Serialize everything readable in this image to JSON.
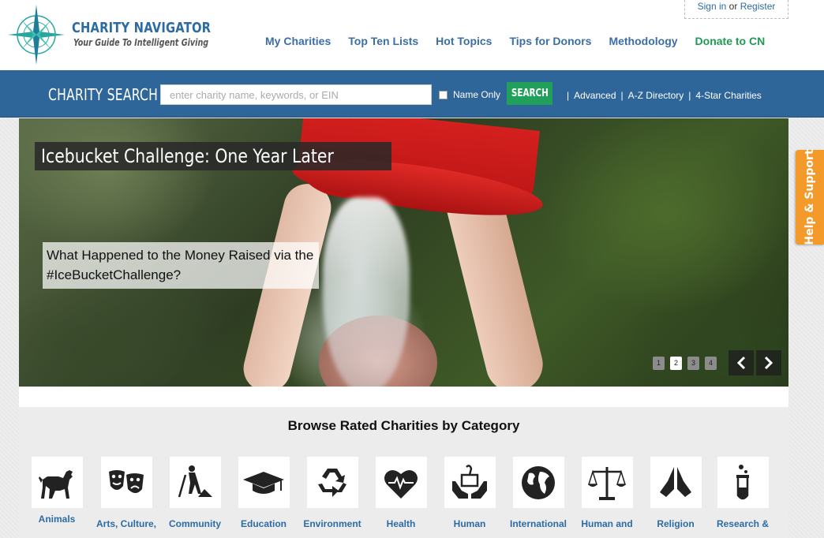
{
  "brand": {
    "title": "CHARITY NAVIGATOR",
    "tagline": "Your Guide To Intelligent Giving"
  },
  "account": {
    "signin": "Sign in",
    "or": "or",
    "register": "Register"
  },
  "topnav": {
    "items": [
      "My Charities",
      "Top Ten Lists",
      "Hot Topics",
      "Tips for Donors",
      "Methodology"
    ],
    "donate": "Donate to CN"
  },
  "search": {
    "label": "CHARITY SEARCH",
    "placeholder": "enter charity name, keywords, or EIN",
    "name_only": "Name Only",
    "button": "SEARCH",
    "links": [
      "Advanced",
      "A-Z Directory",
      "4-Star Charities"
    ]
  },
  "hero": {
    "title": "Icebucket Challenge: One Year Later",
    "caption": "What Happened to the Money Raised via the #IceBucketChallenge?",
    "slides": [
      "1",
      "2",
      "3",
      "4"
    ],
    "active_slide": 2
  },
  "help": {
    "label": "Help & Support"
  },
  "browse": {
    "title": "Browse Rated Charities by Category",
    "categories": [
      {
        "label": "Animals",
        "icon": "dog-icon"
      },
      {
        "label": "Arts, Culture,",
        "icon": "theater-masks-icon"
      },
      {
        "label": "Community",
        "icon": "worker-shovel-icon"
      },
      {
        "label": "Education",
        "icon": "graduation-cap-icon"
      },
      {
        "label": "Environment",
        "icon": "recycle-icon"
      },
      {
        "label": "Health",
        "icon": "heart-pulse-icon"
      },
      {
        "label": "Human",
        "icon": "hands-box-icon"
      },
      {
        "label": "International",
        "icon": "globe-icon"
      },
      {
        "label": "Human and",
        "icon": "scales-icon"
      },
      {
        "label": "Religion",
        "icon": "praying-hands-icon"
      },
      {
        "label": "Research &",
        "icon": "test-tube-icon"
      }
    ]
  },
  "colors": {
    "brand_blue": "#2f6699",
    "link_blue": "#3a6ea5",
    "donate_green": "#1f9a54",
    "search_green": "#20a05a",
    "help_orange": "#f39a2b"
  }
}
